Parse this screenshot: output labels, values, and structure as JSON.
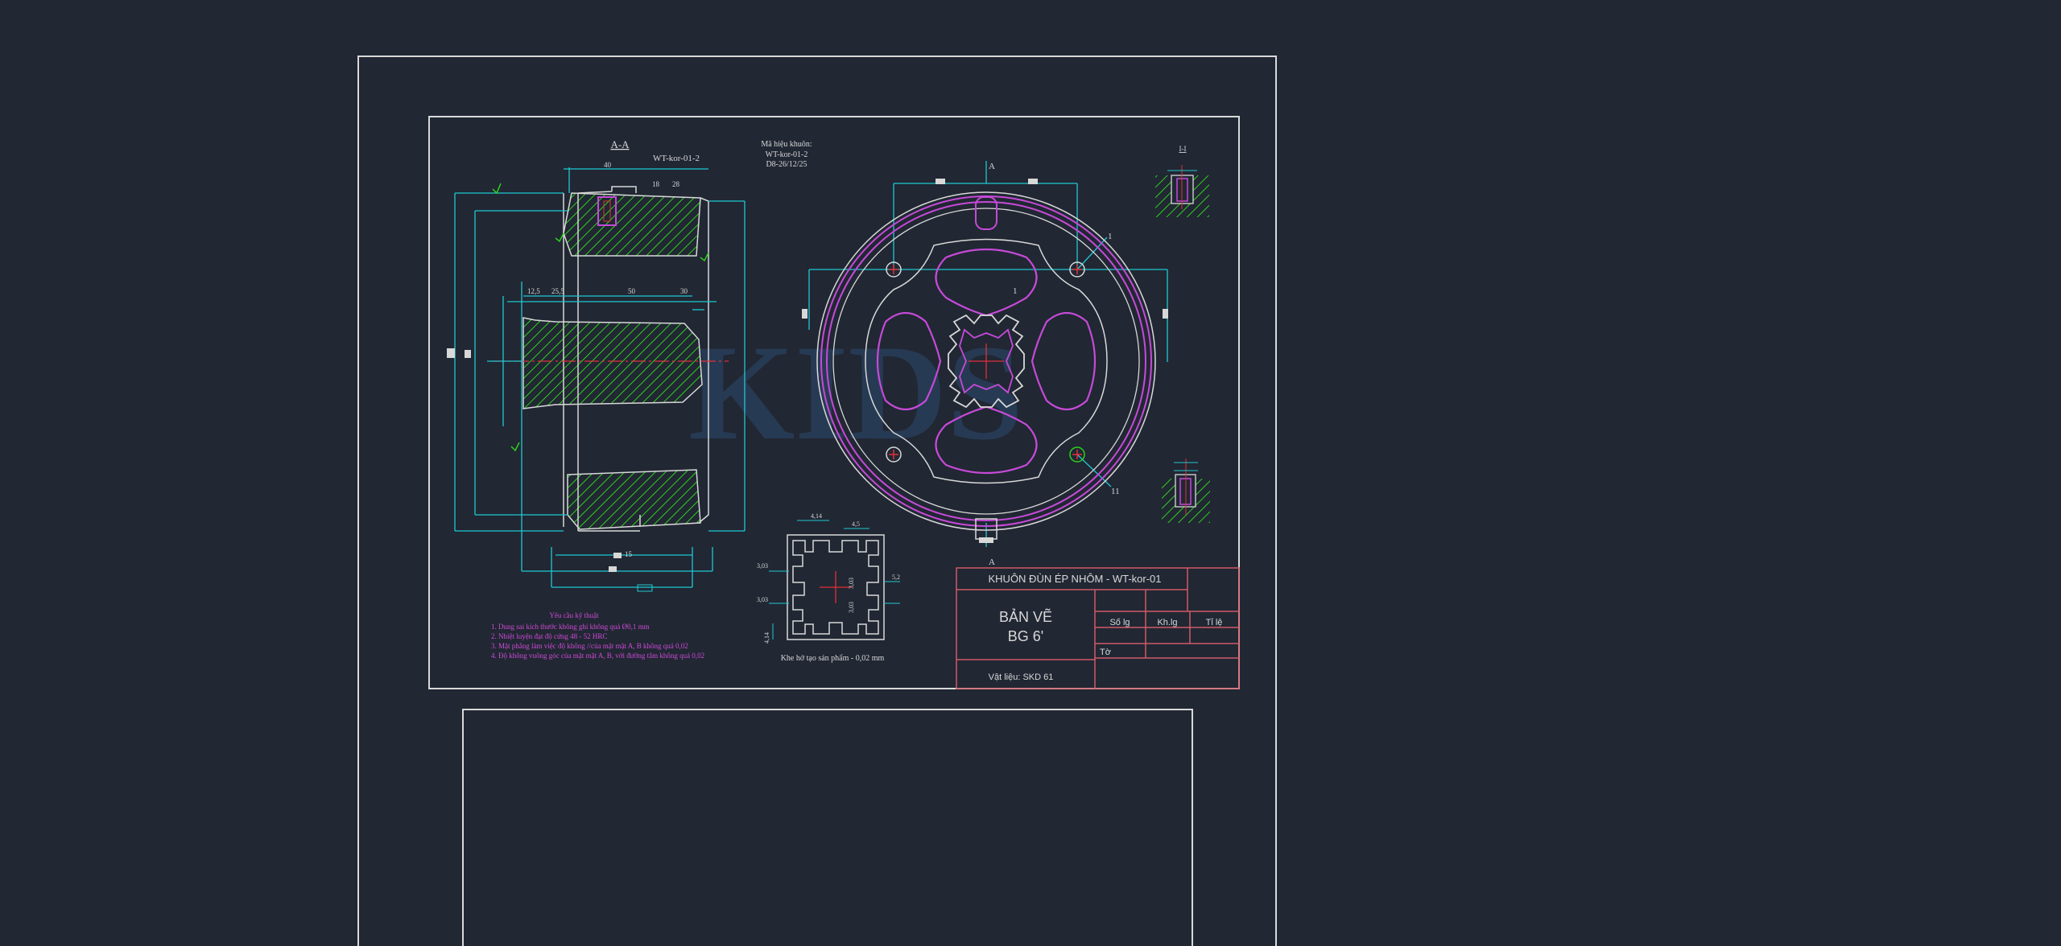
{
  "colors": {
    "background": "#212733",
    "frame": "#d9d9d9",
    "dimension": "#1ec8d2",
    "hatch": "#2fd01e",
    "contour": "#d8d8d8",
    "pocket": "#c64ad8",
    "centerline": "#e0303a",
    "titleblock": "#d05a68",
    "note": "#d04ad8",
    "watermark": "#2c4a6e"
  },
  "drawing": {
    "section_title": "A-A",
    "die_code_label": "WT-kor-01-2",
    "die_info": [
      "Mã hiệu khuôn:",
      "WT-kor-01-2",
      "D8-26/12/25"
    ],
    "section_dims": [
      "40",
      "28",
      "18",
      "50",
      "30",
      "15",
      "12,5",
      "25,5"
    ],
    "front_marks": [
      "A",
      "A",
      "1",
      "1",
      "11"
    ],
    "detail_label": "I-I",
    "profile_caption": "Khe hở tạo sản phẩm - 0,02 mm",
    "profile_dims": [
      "4,14",
      "4,5",
      "3,03",
      "3,03",
      "3,03",
      "3,03",
      "5,2",
      "4,14"
    ],
    "notes_title": "Yêu cầu kỹ thuật",
    "notes": [
      "1. Dung sai kích thước không ghi không quá Ø0,1 mm",
      "2. Nhiệt luyện đạt độ cứng 48 - 52 HRC",
      "3. Mặt phẳng làm việc độ không //của mặt mặt A, B không quá 0,02",
      "4. Độ không vuông góc của mặt mặt A, B, với đường tâm không quá 0,02"
    ],
    "watermark": "KIDS"
  },
  "titleblock": {
    "title": "KHUÔN ĐÙN ÉP NHÔM - WT-kor-01",
    "ban_ve": "BẢN VẼ",
    "bg": "BG 6'",
    "col1": "Số lg",
    "col2": "Kh.lg",
    "col3": "Tỉ lệ",
    "to": "Tờ",
    "vat_lieu": "Vật liệu: SKD 61"
  }
}
